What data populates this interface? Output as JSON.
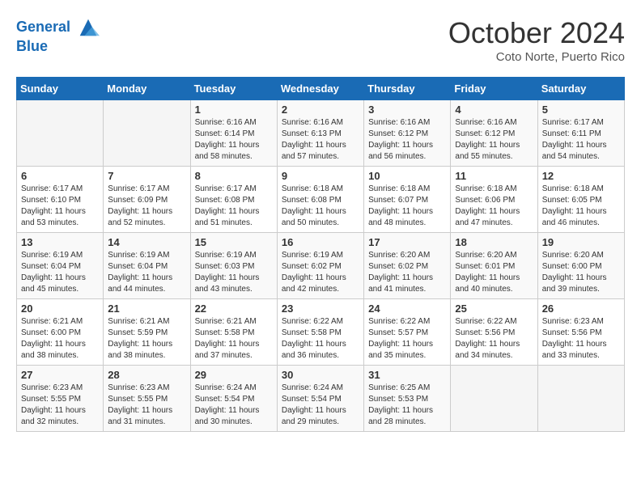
{
  "header": {
    "logo_line1": "General",
    "logo_line2": "Blue",
    "month": "October 2024",
    "location": "Coto Norte, Puerto Rico"
  },
  "days_of_week": [
    "Sunday",
    "Monday",
    "Tuesday",
    "Wednesday",
    "Thursday",
    "Friday",
    "Saturday"
  ],
  "weeks": [
    [
      {
        "day": "",
        "info": ""
      },
      {
        "day": "",
        "info": ""
      },
      {
        "day": "1",
        "info": "Sunrise: 6:16 AM\nSunset: 6:14 PM\nDaylight: 11 hours and 58 minutes."
      },
      {
        "day": "2",
        "info": "Sunrise: 6:16 AM\nSunset: 6:13 PM\nDaylight: 11 hours and 57 minutes."
      },
      {
        "day": "3",
        "info": "Sunrise: 6:16 AM\nSunset: 6:12 PM\nDaylight: 11 hours and 56 minutes."
      },
      {
        "day": "4",
        "info": "Sunrise: 6:16 AM\nSunset: 6:12 PM\nDaylight: 11 hours and 55 minutes."
      },
      {
        "day": "5",
        "info": "Sunrise: 6:17 AM\nSunset: 6:11 PM\nDaylight: 11 hours and 54 minutes."
      }
    ],
    [
      {
        "day": "6",
        "info": "Sunrise: 6:17 AM\nSunset: 6:10 PM\nDaylight: 11 hours and 53 minutes."
      },
      {
        "day": "7",
        "info": "Sunrise: 6:17 AM\nSunset: 6:09 PM\nDaylight: 11 hours and 52 minutes."
      },
      {
        "day": "8",
        "info": "Sunrise: 6:17 AM\nSunset: 6:08 PM\nDaylight: 11 hours and 51 minutes."
      },
      {
        "day": "9",
        "info": "Sunrise: 6:18 AM\nSunset: 6:08 PM\nDaylight: 11 hours and 50 minutes."
      },
      {
        "day": "10",
        "info": "Sunrise: 6:18 AM\nSunset: 6:07 PM\nDaylight: 11 hours and 48 minutes."
      },
      {
        "day": "11",
        "info": "Sunrise: 6:18 AM\nSunset: 6:06 PM\nDaylight: 11 hours and 47 minutes."
      },
      {
        "day": "12",
        "info": "Sunrise: 6:18 AM\nSunset: 6:05 PM\nDaylight: 11 hours and 46 minutes."
      }
    ],
    [
      {
        "day": "13",
        "info": "Sunrise: 6:19 AM\nSunset: 6:04 PM\nDaylight: 11 hours and 45 minutes."
      },
      {
        "day": "14",
        "info": "Sunrise: 6:19 AM\nSunset: 6:04 PM\nDaylight: 11 hours and 44 minutes."
      },
      {
        "day": "15",
        "info": "Sunrise: 6:19 AM\nSunset: 6:03 PM\nDaylight: 11 hours and 43 minutes."
      },
      {
        "day": "16",
        "info": "Sunrise: 6:19 AM\nSunset: 6:02 PM\nDaylight: 11 hours and 42 minutes."
      },
      {
        "day": "17",
        "info": "Sunrise: 6:20 AM\nSunset: 6:02 PM\nDaylight: 11 hours and 41 minutes."
      },
      {
        "day": "18",
        "info": "Sunrise: 6:20 AM\nSunset: 6:01 PM\nDaylight: 11 hours and 40 minutes."
      },
      {
        "day": "19",
        "info": "Sunrise: 6:20 AM\nSunset: 6:00 PM\nDaylight: 11 hours and 39 minutes."
      }
    ],
    [
      {
        "day": "20",
        "info": "Sunrise: 6:21 AM\nSunset: 6:00 PM\nDaylight: 11 hours and 38 minutes."
      },
      {
        "day": "21",
        "info": "Sunrise: 6:21 AM\nSunset: 5:59 PM\nDaylight: 11 hours and 38 minutes."
      },
      {
        "day": "22",
        "info": "Sunrise: 6:21 AM\nSunset: 5:58 PM\nDaylight: 11 hours and 37 minutes."
      },
      {
        "day": "23",
        "info": "Sunrise: 6:22 AM\nSunset: 5:58 PM\nDaylight: 11 hours and 36 minutes."
      },
      {
        "day": "24",
        "info": "Sunrise: 6:22 AM\nSunset: 5:57 PM\nDaylight: 11 hours and 35 minutes."
      },
      {
        "day": "25",
        "info": "Sunrise: 6:22 AM\nSunset: 5:56 PM\nDaylight: 11 hours and 34 minutes."
      },
      {
        "day": "26",
        "info": "Sunrise: 6:23 AM\nSunset: 5:56 PM\nDaylight: 11 hours and 33 minutes."
      }
    ],
    [
      {
        "day": "27",
        "info": "Sunrise: 6:23 AM\nSunset: 5:55 PM\nDaylight: 11 hours and 32 minutes."
      },
      {
        "day": "28",
        "info": "Sunrise: 6:23 AM\nSunset: 5:55 PM\nDaylight: 11 hours and 31 minutes."
      },
      {
        "day": "29",
        "info": "Sunrise: 6:24 AM\nSunset: 5:54 PM\nDaylight: 11 hours and 30 minutes."
      },
      {
        "day": "30",
        "info": "Sunrise: 6:24 AM\nSunset: 5:54 PM\nDaylight: 11 hours and 29 minutes."
      },
      {
        "day": "31",
        "info": "Sunrise: 6:25 AM\nSunset: 5:53 PM\nDaylight: 11 hours and 28 minutes."
      },
      {
        "day": "",
        "info": ""
      },
      {
        "day": "",
        "info": ""
      }
    ]
  ]
}
